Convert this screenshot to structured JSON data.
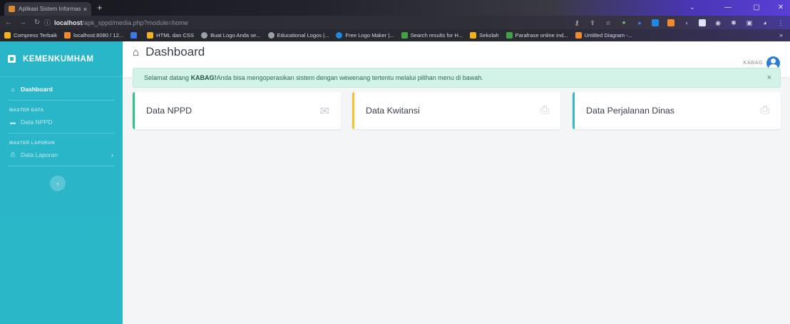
{
  "browser": {
    "tab_title": "Aplikasi Sistem Informasi Surat P",
    "tab_close": "×",
    "new_tab": "+",
    "url_host": "localhost",
    "url_path": "/apk_sppd/media.php?module=home",
    "bookmarks": [
      {
        "label": "Compress Terbaik",
        "color": "#f2b01e"
      },
      {
        "label": "localhost:8080 / 12...",
        "color": "#f08a2c"
      },
      {
        "label": "",
        "color": "#3d7ae8"
      },
      {
        "label": "HTML dan CSS",
        "color": "#f2b01e"
      },
      {
        "label": "Buat Logo Anda se...",
        "color": "#9aa0a6"
      },
      {
        "label": "Educational Logos |...",
        "color": "#9aa0a6"
      },
      {
        "label": "Free Logo Maker |...",
        "color": "#1e88e5"
      },
      {
        "label": "Search results for H...",
        "color": "#43a047"
      },
      {
        "label": "Sekolah",
        "color": "#f2b01e"
      },
      {
        "label": "Parafrase online ind...",
        "color": "#43a047"
      },
      {
        "label": "Untitled Diagram -...",
        "color": "#f08a2c"
      }
    ],
    "bookmarks_more": "»"
  },
  "sidebar": {
    "brand": "KEMENKUMHAM",
    "dashboard": "Dashboard",
    "heading_master_data": "MASTER DATA",
    "data_nppd": "Data NPPD",
    "heading_master_laporan": "MASTER LAPORAN",
    "data_laporan": "Data Laporan",
    "collapse": "‹"
  },
  "topbar": {
    "user": "KABAG"
  },
  "main": {
    "title": "Dashboard",
    "alert_prefix": "Selamat datang ",
    "alert_user": "KABAG!",
    "alert_suffix": " Anda bisa mengoperasikan sistem dengan wewenang tertentu melalui pilihan menu di bawah.",
    "alert_close": "×",
    "cards": [
      {
        "label": "Data NPPD",
        "icon": "envelope-open-icon",
        "accent": "#2fc28f"
      },
      {
        "label": "Data Kwitansi",
        "icon": "print-icon",
        "accent": "#f2c230"
      },
      {
        "label": "Data Perjalanan Dinas",
        "icon": "print-icon",
        "accent": "#36b9cc"
      }
    ]
  }
}
